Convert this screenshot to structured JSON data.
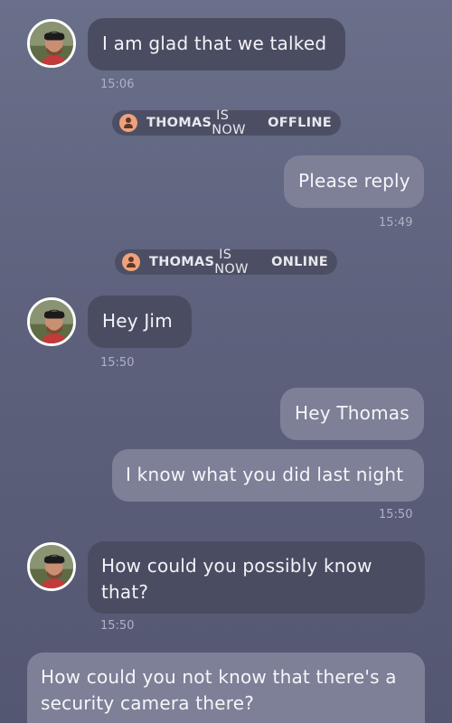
{
  "contact": {
    "name": "Thomas",
    "avatar_icon": "avatar-photo"
  },
  "messages": [
    {
      "direction": "in",
      "text": "I am glad that we talked",
      "time": "15:06"
    },
    {
      "direction": "out",
      "text": "Please reply",
      "time": "15:49"
    },
    {
      "direction": "in",
      "text": "Hey Jim",
      "time": "15:50"
    },
    {
      "direction": "out",
      "text": "Hey Thomas"
    },
    {
      "direction": "out",
      "text": "I know what you did last night",
      "time": "15:50"
    },
    {
      "direction": "in",
      "text": "How could you possibly know that?",
      "time": "15:50"
    },
    {
      "direction": "out",
      "text": "How could you not know that there's a security camera there?"
    }
  ],
  "notices": [
    {
      "name": "THOMAS",
      "middle": "IS NOW",
      "status": "OFFLINE",
      "icon": "user-icon"
    },
    {
      "name": "THOMAS",
      "middle": "IS NOW",
      "status": "ONLINE",
      "icon": "user-icon"
    }
  ],
  "colors": {
    "incoming_bubble": "#4a4d62",
    "outgoing_bubble": "#7d8097",
    "status_icon": "#f0a17c"
  }
}
